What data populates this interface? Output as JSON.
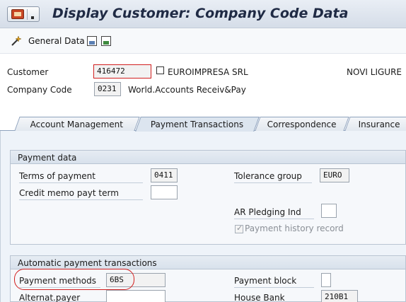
{
  "window": {
    "title": "Display Customer: Company Code Data"
  },
  "toolbar": {
    "general_data_label": "General Data"
  },
  "header": {
    "customer_label": "Customer",
    "customer_value": "416472",
    "customer_name": "EUROIMPRESA SRL",
    "customer_city": "NOVI LIGURE",
    "company_code_label": "Company Code",
    "company_code_value": "0231",
    "company_code_name": "World.Accounts Receiv&Pay"
  },
  "tabs": [
    {
      "label": "Account Management",
      "active": false
    },
    {
      "label": "Payment Transactions",
      "active": true
    },
    {
      "label": "Correspondence",
      "active": false
    },
    {
      "label": "Insurance",
      "active": false
    }
  ],
  "payment_data": {
    "title": "Payment data",
    "terms_of_payment_label": "Terms of payment",
    "terms_of_payment_value": "0411",
    "credit_memo_label": "Credit memo payt term",
    "credit_memo_value": "",
    "tolerance_group_label": "Tolerance group",
    "tolerance_group_value": "EURO",
    "ar_pledging_label": "AR Pledging Ind",
    "ar_pledging_value": "",
    "payment_history_label": "Payment history record",
    "payment_history_checked": true
  },
  "auto_payment": {
    "title": "Automatic payment transactions",
    "payment_methods_label": "Payment methods",
    "payment_methods_value": "6BS",
    "alternat_payer_label": "Alternat.payer",
    "alternat_payer_value": "",
    "payment_block_label": "Payment block",
    "payment_block_value": "",
    "house_bank_label": "House Bank",
    "house_bank_value": "210B1"
  },
  "colors": {
    "highlight": "#d21f1f",
    "title_text": "#1f2a44",
    "panel_bg": "#eef3f9"
  }
}
